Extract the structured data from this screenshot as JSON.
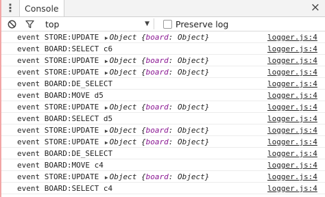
{
  "tabbar": {
    "menu_icon": "vertical-dots-icon",
    "tab_label": "Console",
    "close_icon": "close-icon",
    "close_glyph": "×"
  },
  "toolbar": {
    "clear_icon": "clear-console-icon",
    "filter_icon": "filter-icon",
    "context_value": "top",
    "dropdown_icon": "triangle-down-icon",
    "preserve_log_label": "Preserve log",
    "preserve_log_checked": false
  },
  "log": {
    "rows": [
      {
        "kind": "store",
        "text": "event STORE:UPDATE",
        "object_label": "Object",
        "key": "board",
        "value_type": "Object",
        "source": "logger.js:4"
      },
      {
        "kind": "plain",
        "text": "event BOARD:SELECT c6",
        "source": "logger.js:4"
      },
      {
        "kind": "store",
        "text": "event STORE:UPDATE",
        "object_label": "Object",
        "key": "board",
        "value_type": "Object",
        "source": "logger.js:4"
      },
      {
        "kind": "store",
        "text": "event STORE:UPDATE",
        "object_label": "Object",
        "key": "board",
        "value_type": "Object",
        "source": "logger.js:4"
      },
      {
        "kind": "plain",
        "text": "event BOARD:DE_SELECT",
        "source": "logger.js:4"
      },
      {
        "kind": "plain",
        "text": "event BOARD:MOVE d5",
        "source": "logger.js:4"
      },
      {
        "kind": "store",
        "text": "event STORE:UPDATE",
        "object_label": "Object",
        "key": "board",
        "value_type": "Object",
        "source": "logger.js:4"
      },
      {
        "kind": "plain",
        "text": "event BOARD:SELECT d5",
        "source": "logger.js:4"
      },
      {
        "kind": "store",
        "text": "event STORE:UPDATE",
        "object_label": "Object",
        "key": "board",
        "value_type": "Object",
        "source": "logger.js:4"
      },
      {
        "kind": "store",
        "text": "event STORE:UPDATE",
        "object_label": "Object",
        "key": "board",
        "value_type": "Object",
        "source": "logger.js:4"
      },
      {
        "kind": "plain",
        "text": "event BOARD:DE_SELECT",
        "source": "logger.js:4"
      },
      {
        "kind": "plain",
        "text": "event BOARD:MOVE c4",
        "source": "logger.js:4"
      },
      {
        "kind": "store",
        "text": "event STORE:UPDATE",
        "object_label": "Object",
        "key": "board",
        "value_type": "Object",
        "source": "logger.js:4"
      },
      {
        "kind": "plain",
        "text": "event BOARD:SELECT c4",
        "source": "logger.js:4"
      }
    ]
  }
}
